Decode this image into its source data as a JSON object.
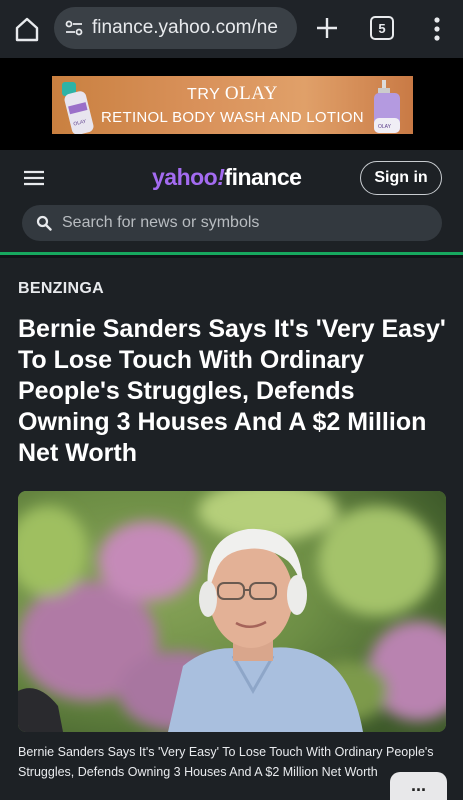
{
  "browser": {
    "url": "finance.yahoo.com/ne",
    "tab_count": "5",
    "icons": [
      "home-icon",
      "tune-icon",
      "plus-icon",
      "tab-switcher-icon",
      "more-vert-icon"
    ]
  },
  "ad": {
    "line1_prefix": "TRY",
    "line1_brand": "OLAY",
    "line2": "RETINOL BODY WASH AND LOTION",
    "bottle_label": "OLAY"
  },
  "header": {
    "logo_yahoo": "yahoo",
    "logo_bang": "!",
    "logo_finance": "finance",
    "signin_label": "Sign in",
    "search_placeholder": "Search for news or symbols",
    "accent_color": "#17a85f",
    "brand_color": "#a36bf0"
  },
  "article": {
    "source": "BENZINGA",
    "headline": "Bernie Sanders Says It's 'Very Easy' To Lose Touch With Ordinary People's Struggles, Defends Owning 3 Houses And A $2 Million Net Worth",
    "caption": "Bernie Sanders Says It's 'Very Easy' To Lose Touch With Ordinary People's Struggles, Defends Owning 3 Houses And A $2 Million Net Worth",
    "more_label": "..."
  }
}
